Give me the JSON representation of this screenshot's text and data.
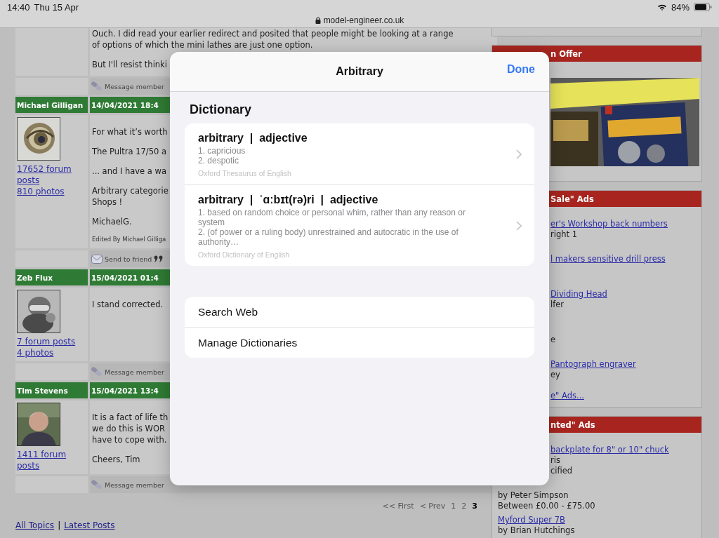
{
  "status_bar": {
    "time": "14:40",
    "date": "Thu 15 Apr",
    "battery": "84%"
  },
  "address_bar": {
    "url": "model-engineer.co.uk"
  },
  "posts": [
    {
      "paragraphs": [
        [
          "Ouch. I did read your earlier redirect and posited that people might be looking at a range",
          "of options of which the mini lathes are just one option."
        ],
        [
          "But I'll resist thinki"
        ]
      ],
      "action": {
        "kind": "message",
        "label": "Message member"
      }
    },
    {
      "author": "Michael Gilligan",
      "date": "14/04/2021 18:4",
      "links": [
        "17652 forum posts",
        "810 photos"
      ],
      "paragraphs": [
        [
          "For what it’s worth"
        ],
        [
          "The Pultra 17/50 a"
        ],
        [
          "... and I have a wa"
        ],
        [
          "Arbitrary categorie",
          "Shops !"
        ],
        [
          "MichaelG."
        ]
      ],
      "edited": "Edited By Michael Gilliga",
      "action": {
        "kind": "send",
        "label": "Send to friend"
      }
    },
    {
      "author": "Zeb Flux",
      "date": "15/04/2021 01:4",
      "links": [
        "7 forum posts",
        "4 photos"
      ],
      "paragraphs": [
        [
          "I stand corrected."
        ]
      ],
      "action": {
        "kind": "message",
        "label": "Message member"
      }
    },
    {
      "author": "Tim Stevens",
      "date": "15/04/2021 13:4",
      "links": [
        "1411 forum posts"
      ],
      "paragraphs": [
        [
          "It is a fact of life th",
          "we do this is WOR",
          "have to cope with."
        ],
        [
          "Cheers, Tim"
        ]
      ],
      "action": {
        "kind": "message",
        "label": "Message member"
      }
    }
  ],
  "pagination": {
    "items": [
      {
        "label": "<< First",
        "selected": false
      },
      {
        "label": "< Prev",
        "selected": false
      },
      {
        "label": "1",
        "selected": false
      },
      {
        "label": "2",
        "selected": false
      },
      {
        "label": "3",
        "selected": true
      }
    ]
  },
  "footer": {
    "links": [
      "All Topics",
      "Latest Posts"
    ],
    "separator": "|"
  },
  "sidebar": {
    "sections": [
      {
        "kind": "offer",
        "title": "n Offer"
      },
      {
        "kind": "ads",
        "title": "Sale\" Ads",
        "ads": [
          {
            "title": "er's Workshop back numbers",
            "by": "right 1"
          },
          {
            "title": "l makers sensitive drill press"
          },
          {
            "title": "Dividing Head",
            "by": "lfer"
          },
          {
            "by": "e"
          },
          {
            "title": "Pantograph engraver",
            "by": "ey"
          }
        ],
        "more": "e\" Ads..."
      },
      {
        "kind": "ads",
        "title": "nted\" Ads",
        "ads": [
          {
            "title": "backplate for 8\" or 10\" chuck",
            "by": "ris",
            "price": "cified"
          },
          {
            "by": "by Peter Simpson",
            "price": "Between £0.00 - £75.00"
          },
          {
            "title": "Myford Super 7B",
            "by": "by Brian Hutchings"
          }
        ]
      }
    ]
  },
  "sheet": {
    "title": "Arbitrary",
    "done": "Done",
    "section": "Dictionary",
    "entries": [
      {
        "headword": "arbitrary  |  adjective",
        "senses": [
          "1. capricious",
          "2. despotic"
        ],
        "source": "Oxford Thesaurus of English"
      },
      {
        "headword": "arbitrary  |  ˈɑːbɪt(rə)ri  |  adjective",
        "senses": [
          "1. based on random choice or personal whim, rather than any reason or system",
          "2. (of power or a ruling body) unrestrained and autocratic in the use of authority…"
        ],
        "source": "Oxford Dictionary of English"
      }
    ],
    "actions": [
      "Search Web",
      "Manage Dictionaries"
    ]
  }
}
